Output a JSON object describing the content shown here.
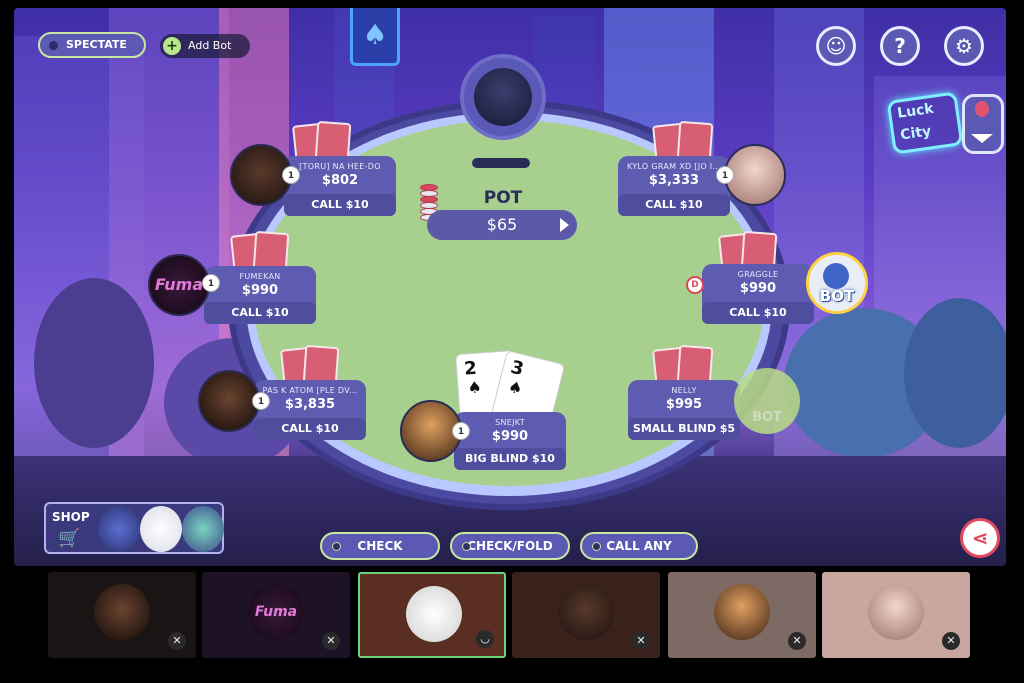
{
  "top_left": {
    "spectate_label": "SPECTATE",
    "add_bot_label": "Add Bot"
  },
  "top_right": {
    "emoji_icon": "smiley-icon",
    "help_icon": "question-icon",
    "settings_icon": "gear-icon"
  },
  "background_sign": "Luck City",
  "pot": {
    "label": "POT",
    "amount": "$65"
  },
  "seats": [
    {
      "name": "[TORU] NA HEE-DO",
      "chips": "$802",
      "action": "CALL $10",
      "badge": "1"
    },
    {
      "name": "KYLO GRAM XD [JO I...",
      "chips": "$3,333",
      "action": "CALL $10",
      "badge": "1"
    },
    {
      "name": "FUMEKAN",
      "chips": "$990",
      "action": "CALL $10",
      "badge": "1",
      "avatar_text": "Fuma"
    },
    {
      "name": "GRAGGLE",
      "chips": "$990",
      "action": "CALL $10",
      "dealer": "D",
      "bot_label": "BOT"
    },
    {
      "name": "PAS K ATOM [PLE DV...",
      "chips": "$3,835",
      "action": "CALL $10",
      "badge": "1"
    },
    {
      "name": "NELLY",
      "chips": "$995",
      "action": "SMALL BLIND $5",
      "bot_label": "BOT"
    },
    {
      "name": "SNEJKT",
      "chips": "$990",
      "action": "BIG BLIND $10",
      "badge": "1"
    }
  ],
  "hole_cards": [
    {
      "rank": "2",
      "suit": "♠"
    },
    {
      "rank": "3",
      "suit": "♠"
    }
  ],
  "shop": {
    "label": "SHOP"
  },
  "actions": {
    "check": "CHECK",
    "check_fold": "CHECK/FOLD",
    "call_any": "CALL ANY"
  },
  "video_tiles": [
    {
      "avatar_text": ""
    },
    {
      "avatar_text": "Fuma"
    },
    {
      "avatar_text": ""
    },
    {
      "avatar_text": ""
    },
    {
      "avatar_text": ""
    },
    {
      "avatar_text": ""
    }
  ],
  "colors": {
    "felt": "#a7d08f",
    "plate": "#5e5cb0",
    "accent_green": "#c8e7a0",
    "card_back": "#d85f73"
  }
}
